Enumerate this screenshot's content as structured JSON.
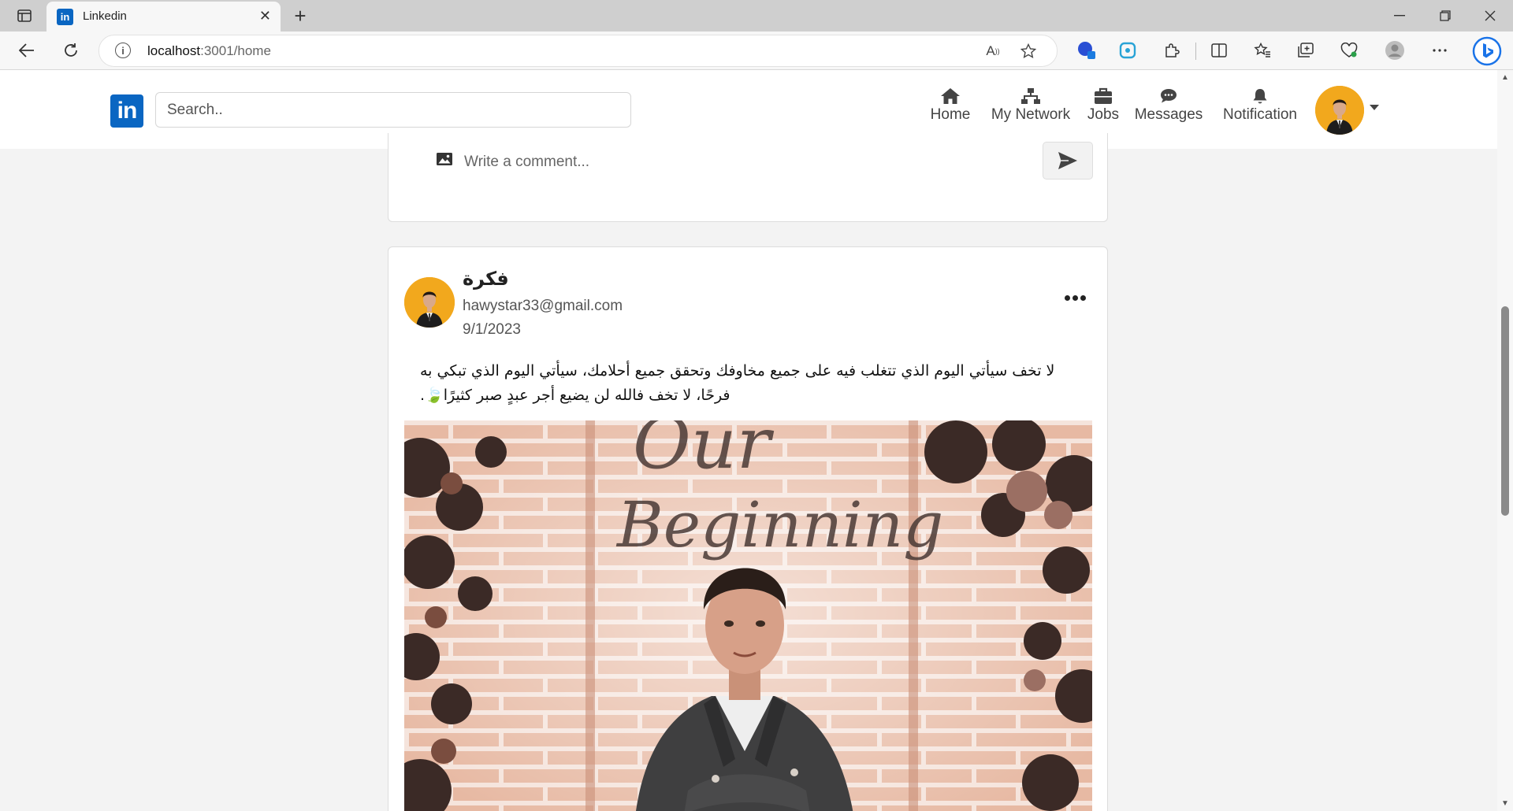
{
  "browser": {
    "tab_title": "Linkedin",
    "tab_favicon_text": "in",
    "url_host": "localhost",
    "url_path": ":3001/home"
  },
  "header": {
    "logo_text": "in",
    "search_placeholder": "Search..",
    "nav": [
      {
        "label": "Home",
        "icon": "home-icon"
      },
      {
        "label": "My Network",
        "icon": "network-icon"
      },
      {
        "label": "Jobs",
        "icon": "briefcase-icon"
      },
      {
        "label": "Messages",
        "icon": "chat-icon"
      },
      {
        "label": "Notification",
        "icon": "bell-icon"
      }
    ]
  },
  "comment": {
    "placeholder": "Write a comment..."
  },
  "post": {
    "author": "فكرة",
    "email": "hawystar33@gmail.com",
    "date": "9/1/2023",
    "text": "لا تخف سيأتي اليوم الذي تتغلب فيه على جميع مخاوفك وتحقق جميع أحلامك، سيأتي اليوم الذي تبكي به فرحًا، لا تخف فالله لن يضيع أجر عبدٍ صبر كثيرًا🍃.",
    "image_overlay_text": "Our Beginning"
  },
  "colors": {
    "linkedin_blue": "#0a66c2",
    "avatar_bg": "#f2a81d"
  }
}
